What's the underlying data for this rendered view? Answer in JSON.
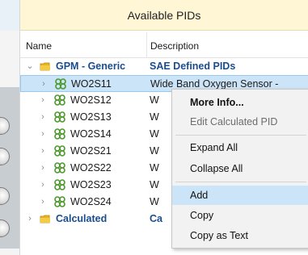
{
  "panel": {
    "title": "Available PIDs"
  },
  "columns": {
    "name": "Name",
    "description": "Description"
  },
  "tree": {
    "root": {
      "name": "GPM - Generic",
      "description": "SAE Defined PIDs"
    },
    "children": [
      {
        "name": "WO2S11",
        "description": "Wide Band Oxygen Sensor -"
      },
      {
        "name": "WO2S12",
        "description": "W"
      },
      {
        "name": "WO2S13",
        "description": "W"
      },
      {
        "name": "WO2S14",
        "description": "W"
      },
      {
        "name": "WO2S21",
        "description": "W"
      },
      {
        "name": "WO2S22",
        "description": "W"
      },
      {
        "name": "WO2S23",
        "description": "W"
      },
      {
        "name": "WO2S24",
        "description": "W"
      }
    ],
    "calculated": {
      "name": "Calculated",
      "description": "Ca"
    }
  },
  "context_menu": {
    "items": [
      {
        "label": "More Info...",
        "bold": true,
        "enabled": true
      },
      {
        "label": "Edit Calculated PID",
        "enabled": false
      },
      {
        "label": "Expand All",
        "enabled": true
      },
      {
        "label": "Collapse All",
        "enabled": true
      },
      {
        "label": "Add",
        "enabled": true,
        "highlighted": true
      },
      {
        "label": "Copy",
        "enabled": true
      },
      {
        "label": "Copy as Text",
        "enabled": true
      }
    ]
  },
  "colors": {
    "title_bg": "#fff6d6",
    "selection": "#cce4f7",
    "group_text": "#1a4d8f",
    "folder": "#e8b520",
    "pid_icon": "#4a9a2a"
  }
}
